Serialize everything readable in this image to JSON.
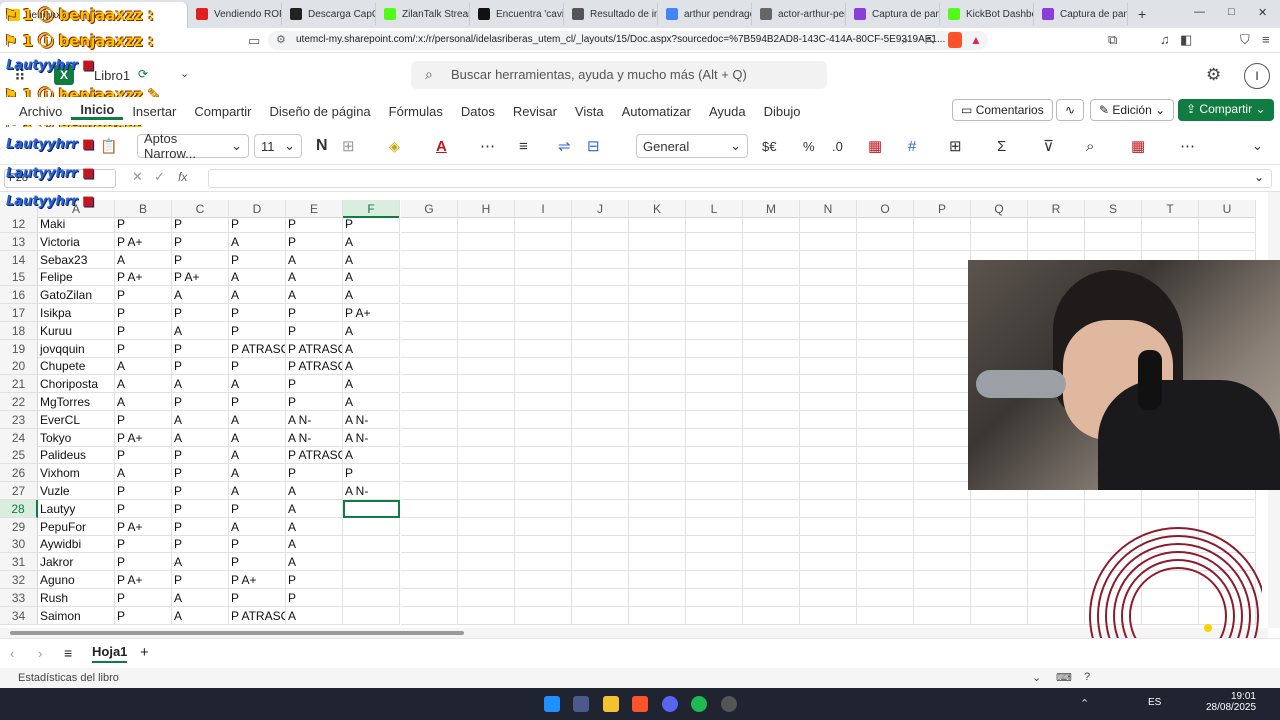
{
  "browser": {
    "tabs": [
      {
        "label": "benjaaxzz",
        "color": "#f6c400",
        "active": true
      },
      {
        "label": "Vendiendo ROPA",
        "color": "#e02020"
      },
      {
        "label": "Descarga CapCut",
        "color": "#222"
      },
      {
        "label": "ZilanTalk Stream",
        "color": "#53fc18"
      },
      {
        "label": "Encuentra 'cavish",
        "color": "#111"
      },
      {
        "label": "Resultado de imá",
        "color": "#555"
      },
      {
        "label": "arthur pendragon",
        "color": "#4285f4"
      },
      {
        "label": "actor-arthur-pen",
        "color": "#666"
      },
      {
        "label": "Captura de panta",
        "color": "#8b3fd9"
      },
      {
        "label": "KickBot Dashboa",
        "color": "#53fc18"
      },
      {
        "label": "Captura de panta",
        "color": "#8b3fd9"
      }
    ],
    "url": "utemcl-my.sharepoint.com/:x:/r/personal/idelasriberas_utem_cl/_layouts/15/Doc.aspx?sourcedoc=%7B594B2AD8-143C-414A-80CF-5E9319AE1..."
  },
  "overlay_names": {
    "streamer": "benjaaxzz",
    "viewer": "Lautyyhrr"
  },
  "app": {
    "workbook_name": "Libro1",
    "search_placeholder": "Buscar herramientas, ayuda y mucho más (Alt + Q)",
    "user_initial": "I",
    "menu": [
      "Archivo",
      "Inicio",
      "Insertar",
      "Compartir",
      "Diseño de página",
      "Fórmulas",
      "Datos",
      "Revisar",
      "Vista",
      "Automatizar",
      "Ayuda",
      "Dibujo"
    ],
    "comments_label": "Comentarios",
    "edit_label": "Edición",
    "share_label": "Compartir"
  },
  "ribbon": {
    "font_name": "Aptos Narrow...",
    "font_size": "11",
    "number_format": "General",
    "currency_symbol": "$€"
  },
  "formula_bar": {
    "name_box": "F28",
    "fx": "fx",
    "value": ""
  },
  "grid": {
    "columns": [
      "A",
      "B",
      "C",
      "D",
      "E",
      "F",
      "G",
      "H",
      "I",
      "J",
      "K",
      "L",
      "M",
      "N",
      "O",
      "P",
      "Q",
      "R",
      "S",
      "T",
      "U"
    ],
    "selected_column": "F",
    "selected_row": "28",
    "rows": [
      {
        "n": "12",
        "cells": [
          "Maki",
          "P",
          "P",
          "P",
          "P",
          "P"
        ]
      },
      {
        "n": "13",
        "cells": [
          "Victoria",
          "P A+",
          "P",
          "A",
          "P",
          "A"
        ]
      },
      {
        "n": "14",
        "cells": [
          "Sebax23",
          "A",
          "P",
          "P",
          "A",
          "A"
        ]
      },
      {
        "n": "15",
        "cells": [
          "Felipe",
          "P A+",
          "P A+",
          "A",
          "A",
          "A"
        ]
      },
      {
        "n": "16",
        "cells": [
          "GatoZilan",
          "P",
          "A",
          "A",
          "A",
          "A"
        ]
      },
      {
        "n": "17",
        "cells": [
          "Isikpa",
          "P",
          "P",
          "P",
          "P",
          "P A+"
        ]
      },
      {
        "n": "18",
        "cells": [
          "Kuruu",
          "P",
          "A",
          "P",
          "P",
          "A"
        ]
      },
      {
        "n": "19",
        "cells": [
          "jovqquin",
          "P",
          "P",
          "P ATRASO",
          "P ATRASO",
          "A"
        ]
      },
      {
        "n": "20",
        "cells": [
          "Chupete",
          "A",
          "P",
          "P",
          "P ATRASO",
          "A"
        ]
      },
      {
        "n": "21",
        "cells": [
          "Choriposta",
          "A",
          "A",
          "A",
          "P",
          "A"
        ]
      },
      {
        "n": "22",
        "cells": [
          "MgTorres",
          "A",
          "P",
          "P",
          "P",
          "A"
        ]
      },
      {
        "n": "23",
        "cells": [
          "EverCL",
          "P",
          "A",
          "A",
          "A N-",
          "A N-"
        ]
      },
      {
        "n": "24",
        "cells": [
          "Tokyo",
          "P A+",
          "A",
          "A",
          "A N-",
          "A N-"
        ]
      },
      {
        "n": "25",
        "cells": [
          "Palideus",
          "P",
          "P",
          "A",
          "P ATRASO",
          "A"
        ]
      },
      {
        "n": "26",
        "cells": [
          "Vixhom",
          "A",
          "P",
          "A",
          "P",
          "P"
        ]
      },
      {
        "n": "27",
        "cells": [
          "Vuzle",
          "P",
          "P",
          "A",
          "A",
          "A N-"
        ]
      },
      {
        "n": "28",
        "cells": [
          "Lautyy",
          "P",
          "P",
          "P",
          "A",
          ""
        ]
      },
      {
        "n": "29",
        "cells": [
          "PepuFor",
          "P A+",
          "P",
          "A",
          "A",
          ""
        ]
      },
      {
        "n": "30",
        "cells": [
          "Aywidbi",
          "P",
          "P",
          "P",
          "A",
          ""
        ]
      },
      {
        "n": "31",
        "cells": [
          "Jakror",
          "P",
          "A",
          "P",
          "A",
          ""
        ]
      },
      {
        "n": "32",
        "cells": [
          "Aguno",
          "P A+",
          "P",
          "P A+",
          "P",
          ""
        ]
      },
      {
        "n": "33",
        "cells": [
          "Rush",
          "P",
          "A",
          "P",
          "P",
          ""
        ]
      },
      {
        "n": "34",
        "cells": [
          "Saimon",
          "P",
          "A",
          "P ATRASO",
          "A",
          ""
        ]
      }
    ]
  },
  "sheets": {
    "active": "Hoja1"
  },
  "status": {
    "text": "Estadísticas del libro"
  },
  "taskbar": {
    "lang": "ES",
    "time": "19:01",
    "date": "28/08/2025"
  },
  "colors": {
    "excel_green": "#107c41",
    "stream_ring": "#8e1b2c"
  }
}
